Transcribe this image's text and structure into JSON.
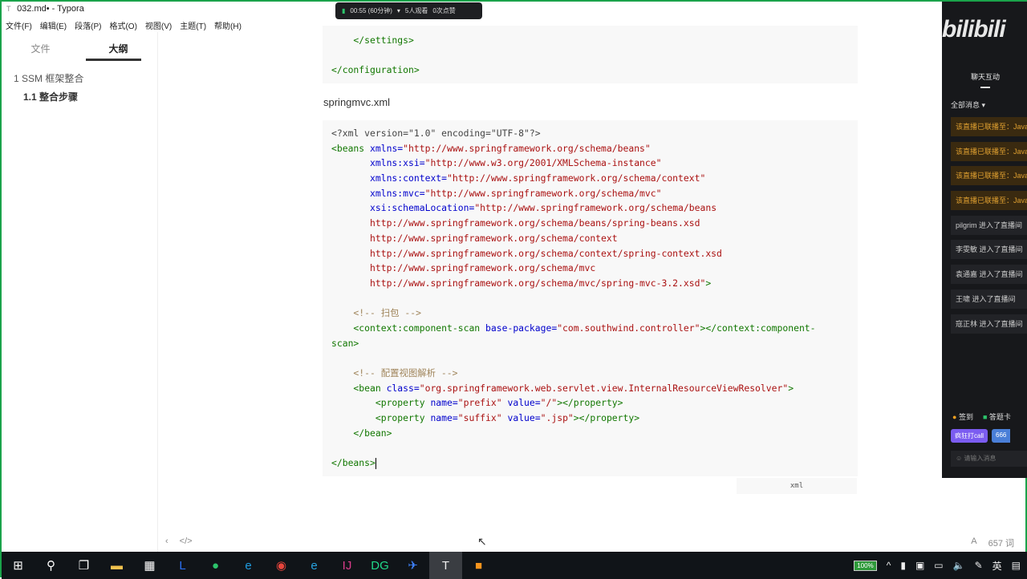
{
  "window": {
    "title": "032.md• - Typora"
  },
  "menu": [
    "文件(F)",
    "编辑(E)",
    "段落(P)",
    "格式(O)",
    "视图(V)",
    "主题(T)",
    "帮助(H)"
  ],
  "sidebar": {
    "tabs": [
      {
        "label": "文件",
        "active": false
      },
      {
        "label": "大纲",
        "active": true
      }
    ],
    "outline": [
      {
        "label": "1 SSM 框架整合",
        "level": 1
      },
      {
        "label": "1.1 整合步骤",
        "level": 2
      }
    ]
  },
  "prev_code": [
    [
      {
        "t": "    </settings>",
        "c": "tag"
      }
    ],
    [],
    [
      {
        "t": "</configuration>",
        "c": "tag"
      }
    ]
  ],
  "heading": "springmvc.xml",
  "code": [
    [
      {
        "t": "<?xml version=\"1.0\" encoding=\"UTF-8\"?>",
        "c": "plain"
      }
    ],
    [
      {
        "t": "<beans ",
        "c": "tag"
      },
      {
        "t": "xmlns=",
        "c": "attr"
      },
      {
        "t": "\"http://www.springframework.org/schema/beans\"",
        "c": "str"
      }
    ],
    [
      {
        "t": "       xmlns:xsi=",
        "c": "attr"
      },
      {
        "t": "\"http://www.w3.org/2001/XMLSchema-instance\"",
        "c": "str"
      }
    ],
    [
      {
        "t": "       xmlns:context=",
        "c": "attr"
      },
      {
        "t": "\"http://www.springframework.org/schema/context\"",
        "c": "str"
      }
    ],
    [
      {
        "t": "       xmlns:mvc=",
        "c": "attr"
      },
      {
        "t": "\"http://www.springframework.org/schema/mvc\"",
        "c": "str"
      }
    ],
    [
      {
        "t": "       xsi:schemaLocation=",
        "c": "attr"
      },
      {
        "t": "\"http://www.springframework.org/schema/beans",
        "c": "str"
      }
    ],
    [
      {
        "t": "       http://www.springframework.org/schema/beans/spring-beans.xsd",
        "c": "str"
      }
    ],
    [
      {
        "t": "       http://www.springframework.org/schema/context",
        "c": "str"
      }
    ],
    [
      {
        "t": "       http://www.springframework.org/schema/context/spring-context.xsd",
        "c": "str"
      }
    ],
    [
      {
        "t": "       http://www.springframework.org/schema/mvc",
        "c": "str"
      }
    ],
    [
      {
        "t": "       http://www.springframework.org/schema/mvc/spring-mvc-3.2.xsd\"",
        "c": "str"
      },
      {
        "t": ">",
        "c": "tag"
      }
    ],
    [],
    [
      {
        "t": "    <!-- 扫包 -->",
        "c": "cmt"
      }
    ],
    [
      {
        "t": "    <context:component-scan ",
        "c": "tag"
      },
      {
        "t": "base-package=",
        "c": "attr"
      },
      {
        "t": "\"com.southwind.controller\"",
        "c": "str"
      },
      {
        "t": "></context:component-",
        "c": "tag"
      }
    ],
    [
      {
        "t": "scan>",
        "c": "tag"
      }
    ],
    [],
    [
      {
        "t": "    <!-- 配置视图解析 -->",
        "c": "cmt"
      }
    ],
    [
      {
        "t": "    <bean ",
        "c": "tag"
      },
      {
        "t": "class=",
        "c": "attr"
      },
      {
        "t": "\"org.springframework.web.servlet.view.InternalResourceViewResolver\"",
        "c": "str"
      },
      {
        "t": ">",
        "c": "tag"
      }
    ],
    [
      {
        "t": "        <property ",
        "c": "tag"
      },
      {
        "t": "name=",
        "c": "attr"
      },
      {
        "t": "\"prefix\" ",
        "c": "str"
      },
      {
        "t": "value=",
        "c": "attr"
      },
      {
        "t": "\"/\"",
        "c": "str"
      },
      {
        "t": "></property>",
        "c": "tag"
      }
    ],
    [
      {
        "t": "        <property ",
        "c": "tag"
      },
      {
        "t": "name=",
        "c": "attr"
      },
      {
        "t": "\"suffix\" ",
        "c": "str"
      },
      {
        "t": "value=",
        "c": "attr"
      },
      {
        "t": "\".jsp\"",
        "c": "str"
      },
      {
        "t": "></property>",
        "c": "tag"
      }
    ],
    [
      {
        "t": "    </bean>",
        "c": "tag"
      }
    ],
    [],
    [
      {
        "t": "</beans>",
        "c": "tag"
      }
    ]
  ],
  "code_language": "xml",
  "status": {
    "word_count": "657 词"
  },
  "live": {
    "duration": "00:55 (60分钟)",
    "viewers": "5人观看",
    "likes": "0次点赞"
  },
  "bili": {
    "logo": "bilibili",
    "chat_title": "聊天互动",
    "filter": "全部消息",
    "messages": [
      {
        "text": "该直播已联播至：Java",
        "system": true
      },
      {
        "text": "该直播已联播至：Java",
        "system": true
      },
      {
        "text": "该直播已联播至：Java",
        "system": true
      },
      {
        "text": "该直播已联播至：Java",
        "system": true
      },
      {
        "text": "pilgrim 进入了直播间",
        "system": false
      },
      {
        "text": "李雯敏 进入了直播间",
        "system": false
      },
      {
        "text": "袁通嘉 进入了直播间",
        "system": false
      },
      {
        "text": "王啸 进入了直播间",
        "system": false
      },
      {
        "text": "寇正林 进入了直播间",
        "system": false
      }
    ],
    "checkin": "签到",
    "card": "答题卡",
    "call": "疯狂打call",
    "six": "666",
    "input_placeholder": "请输入消息"
  },
  "taskbar": {
    "battery": "100%",
    "ime": "英",
    "apps": [
      "start-icon",
      "search-icon",
      "task-view-icon",
      "file-explorer-icon",
      "store-icon",
      "lark-icon",
      "wechat-icon",
      "edge-icon",
      "chrome-icon",
      "edge-dev-icon",
      "intellij-icon",
      "datagrip-icon",
      "feishu-icon",
      "typora-icon",
      "live-app-icon"
    ]
  }
}
